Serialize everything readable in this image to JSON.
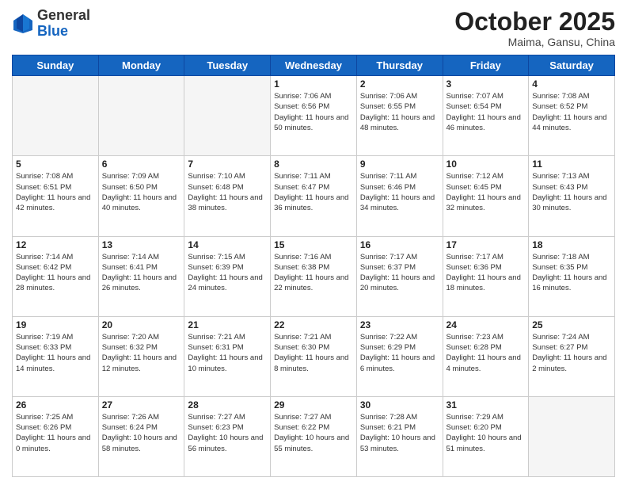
{
  "header": {
    "logo_general": "General",
    "logo_blue": "Blue",
    "month_title": "October 2025",
    "location": "Maima, Gansu, China"
  },
  "weekdays": [
    "Sunday",
    "Monday",
    "Tuesday",
    "Wednesday",
    "Thursday",
    "Friday",
    "Saturday"
  ],
  "weeks": [
    [
      {
        "day": "",
        "info": ""
      },
      {
        "day": "",
        "info": ""
      },
      {
        "day": "",
        "info": ""
      },
      {
        "day": "1",
        "info": "Sunrise: 7:06 AM\nSunset: 6:56 PM\nDaylight: 11 hours\nand 50 minutes."
      },
      {
        "day": "2",
        "info": "Sunrise: 7:06 AM\nSunset: 6:55 PM\nDaylight: 11 hours\nand 48 minutes."
      },
      {
        "day": "3",
        "info": "Sunrise: 7:07 AM\nSunset: 6:54 PM\nDaylight: 11 hours\nand 46 minutes."
      },
      {
        "day": "4",
        "info": "Sunrise: 7:08 AM\nSunset: 6:52 PM\nDaylight: 11 hours\nand 44 minutes."
      }
    ],
    [
      {
        "day": "5",
        "info": "Sunrise: 7:08 AM\nSunset: 6:51 PM\nDaylight: 11 hours\nand 42 minutes."
      },
      {
        "day": "6",
        "info": "Sunrise: 7:09 AM\nSunset: 6:50 PM\nDaylight: 11 hours\nand 40 minutes."
      },
      {
        "day": "7",
        "info": "Sunrise: 7:10 AM\nSunset: 6:48 PM\nDaylight: 11 hours\nand 38 minutes."
      },
      {
        "day": "8",
        "info": "Sunrise: 7:11 AM\nSunset: 6:47 PM\nDaylight: 11 hours\nand 36 minutes."
      },
      {
        "day": "9",
        "info": "Sunrise: 7:11 AM\nSunset: 6:46 PM\nDaylight: 11 hours\nand 34 minutes."
      },
      {
        "day": "10",
        "info": "Sunrise: 7:12 AM\nSunset: 6:45 PM\nDaylight: 11 hours\nand 32 minutes."
      },
      {
        "day": "11",
        "info": "Sunrise: 7:13 AM\nSunset: 6:43 PM\nDaylight: 11 hours\nand 30 minutes."
      }
    ],
    [
      {
        "day": "12",
        "info": "Sunrise: 7:14 AM\nSunset: 6:42 PM\nDaylight: 11 hours\nand 28 minutes."
      },
      {
        "day": "13",
        "info": "Sunrise: 7:14 AM\nSunset: 6:41 PM\nDaylight: 11 hours\nand 26 minutes."
      },
      {
        "day": "14",
        "info": "Sunrise: 7:15 AM\nSunset: 6:39 PM\nDaylight: 11 hours\nand 24 minutes."
      },
      {
        "day": "15",
        "info": "Sunrise: 7:16 AM\nSunset: 6:38 PM\nDaylight: 11 hours\nand 22 minutes."
      },
      {
        "day": "16",
        "info": "Sunrise: 7:17 AM\nSunset: 6:37 PM\nDaylight: 11 hours\nand 20 minutes."
      },
      {
        "day": "17",
        "info": "Sunrise: 7:17 AM\nSunset: 6:36 PM\nDaylight: 11 hours\nand 18 minutes."
      },
      {
        "day": "18",
        "info": "Sunrise: 7:18 AM\nSunset: 6:35 PM\nDaylight: 11 hours\nand 16 minutes."
      }
    ],
    [
      {
        "day": "19",
        "info": "Sunrise: 7:19 AM\nSunset: 6:33 PM\nDaylight: 11 hours\nand 14 minutes."
      },
      {
        "day": "20",
        "info": "Sunrise: 7:20 AM\nSunset: 6:32 PM\nDaylight: 11 hours\nand 12 minutes."
      },
      {
        "day": "21",
        "info": "Sunrise: 7:21 AM\nSunset: 6:31 PM\nDaylight: 11 hours\nand 10 minutes."
      },
      {
        "day": "22",
        "info": "Sunrise: 7:21 AM\nSunset: 6:30 PM\nDaylight: 11 hours\nand 8 minutes."
      },
      {
        "day": "23",
        "info": "Sunrise: 7:22 AM\nSunset: 6:29 PM\nDaylight: 11 hours\nand 6 minutes."
      },
      {
        "day": "24",
        "info": "Sunrise: 7:23 AM\nSunset: 6:28 PM\nDaylight: 11 hours\nand 4 minutes."
      },
      {
        "day": "25",
        "info": "Sunrise: 7:24 AM\nSunset: 6:27 PM\nDaylight: 11 hours\nand 2 minutes."
      }
    ],
    [
      {
        "day": "26",
        "info": "Sunrise: 7:25 AM\nSunset: 6:26 PM\nDaylight: 11 hours\nand 0 minutes."
      },
      {
        "day": "27",
        "info": "Sunrise: 7:26 AM\nSunset: 6:24 PM\nDaylight: 10 hours\nand 58 minutes."
      },
      {
        "day": "28",
        "info": "Sunrise: 7:27 AM\nSunset: 6:23 PM\nDaylight: 10 hours\nand 56 minutes."
      },
      {
        "day": "29",
        "info": "Sunrise: 7:27 AM\nSunset: 6:22 PM\nDaylight: 10 hours\nand 55 minutes."
      },
      {
        "day": "30",
        "info": "Sunrise: 7:28 AM\nSunset: 6:21 PM\nDaylight: 10 hours\nand 53 minutes."
      },
      {
        "day": "31",
        "info": "Sunrise: 7:29 AM\nSunset: 6:20 PM\nDaylight: 10 hours\nand 51 minutes."
      },
      {
        "day": "",
        "info": ""
      }
    ]
  ]
}
